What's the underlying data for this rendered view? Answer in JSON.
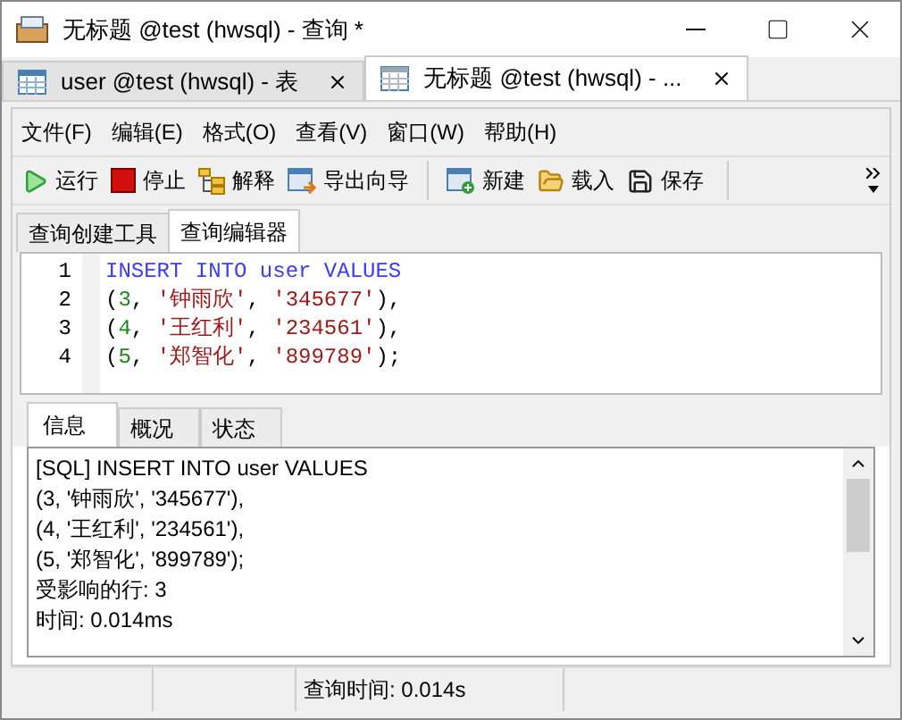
{
  "window": {
    "title": "无标题 @test (hwsql) - 查询 *"
  },
  "doc_tabs": [
    {
      "label": "user @test (hwsql) - 表",
      "kind": "table",
      "selected": false
    },
    {
      "label": "无标题 @test (hwsql) - ...",
      "kind": "query",
      "selected": true
    }
  ],
  "menu": [
    "文件(F)",
    "编辑(E)",
    "格式(O)",
    "查看(V)",
    "窗口(W)",
    "帮助(H)"
  ],
  "toolbar": [
    {
      "label": "运行",
      "kind": "run"
    },
    {
      "label": "停止",
      "kind": "stop"
    },
    {
      "label": "解释",
      "kind": "explain"
    },
    {
      "label": "导出向导",
      "kind": "export"
    },
    {
      "kind": "separator"
    },
    {
      "label": "新建",
      "kind": "new"
    },
    {
      "label": "载入",
      "kind": "load"
    },
    {
      "label": "保存",
      "kind": "save"
    }
  ],
  "editor_tabs": [
    {
      "label": "查询创建工具",
      "selected": false
    },
    {
      "label": "查询编辑器",
      "selected": true
    }
  ],
  "code": [
    {
      "number": "1",
      "tokens": [
        {
          "kind": "keyword",
          "text": "INSERT INTO user VALUES"
        }
      ]
    },
    {
      "number": "2",
      "tokens": [
        {
          "kind": "punct",
          "text": "("
        },
        {
          "kind": "number",
          "text": "3"
        },
        {
          "kind": "punct",
          "text": ", "
        },
        {
          "kind": "string",
          "text": "'钟雨欣'"
        },
        {
          "kind": "punct",
          "text": ", "
        },
        {
          "kind": "string",
          "text": "'345677'"
        },
        {
          "kind": "punct",
          "text": "),"
        }
      ]
    },
    {
      "number": "3",
      "tokens": [
        {
          "kind": "punct",
          "text": "("
        },
        {
          "kind": "number",
          "text": "4"
        },
        {
          "kind": "punct",
          "text": ", "
        },
        {
          "kind": "string",
          "text": "'王红利'"
        },
        {
          "kind": "punct",
          "text": ", "
        },
        {
          "kind": "string",
          "text": "'234561'"
        },
        {
          "kind": "punct",
          "text": "),"
        }
      ]
    },
    {
      "number": "4",
      "tokens": [
        {
          "kind": "punct",
          "text": "("
        },
        {
          "kind": "number",
          "text": "5"
        },
        {
          "kind": "punct",
          "text": ", "
        },
        {
          "kind": "string",
          "text": "'郑智化'"
        },
        {
          "kind": "punct",
          "text": ", "
        },
        {
          "kind": "string",
          "text": "'899789'"
        },
        {
          "kind": "punct",
          "text": ");"
        }
      ]
    }
  ],
  "result_tabs": [
    {
      "label": "信息",
      "selected": true
    },
    {
      "label": "概况",
      "selected": false
    },
    {
      "label": "状态",
      "selected": false
    }
  ],
  "messages": [
    "[SQL] INSERT INTO user VALUES",
    "(3, '钟雨欣', '345677'),",
    "(4, '王红利', '234561'),",
    "(5, '郑智化', '899789');",
    "受影响的行: 3",
    "时间: 0.014ms"
  ],
  "status_bar": {
    "query_time": "查询时间: 0.014s"
  }
}
